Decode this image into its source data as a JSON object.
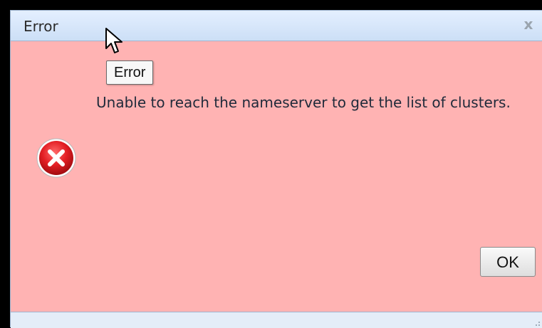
{
  "dialog": {
    "title": "Error",
    "close_label": "x",
    "tooltip": "Error",
    "message": "Unable to reach the nameserver to get the list of clusters.",
    "ok_label": "OK"
  },
  "icons": {
    "status": "error-x-circle-icon",
    "pointer": "mouse-cursor-icon"
  },
  "colors": {
    "body_background": "#ffb3b3",
    "titlebar_background": "#ccdff6",
    "error_icon_red": "#e31e24"
  }
}
